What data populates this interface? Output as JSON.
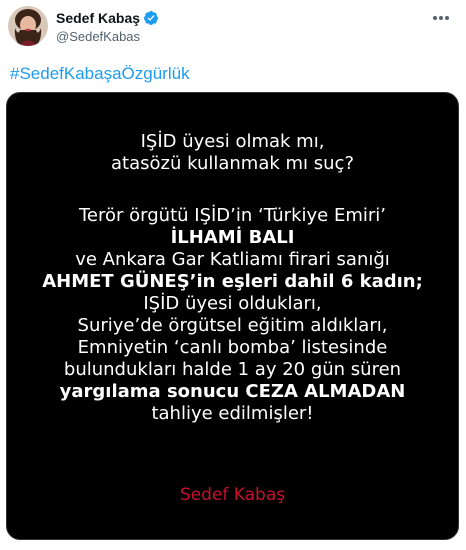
{
  "author": {
    "display_name": "Sedef Kabaş",
    "handle": "@SedefKabas"
  },
  "tweet": {
    "hashtag": "#SedefKabaşaÖzgürlük"
  },
  "image": {
    "lines": [
      "IŞİD üyesi olmak mı,",
      "atasözü kullanmak mı suç?",
      "Terör örgütü IŞİD’in ‘Türkiye Emiri’",
      "İLHAMİ BALI",
      "ve Ankara Gar Katliamı firari sanığı",
      "AHMET GÜNEŞ’in eşleri dahil 6 kadın;",
      "IŞİD üyesi oldukları,",
      "Suriye’de örgütsel eğitim aldıkları,",
      "Emniyetin ‘canlı bomba’ listesinde",
      "bulundukları halde 1 ay 20 gün süren",
      "yargılama sonucu CEZA ALMADAN",
      "tahliye edilmişler!"
    ],
    "signature": "Sedef Kabaş",
    "signature_color": "#c8102e"
  },
  "colors": {
    "link": "#1d9bf0",
    "verified": "#1d9bf0"
  },
  "icons": {
    "verified": "verified-badge-icon",
    "more": "more-options-icon"
  }
}
